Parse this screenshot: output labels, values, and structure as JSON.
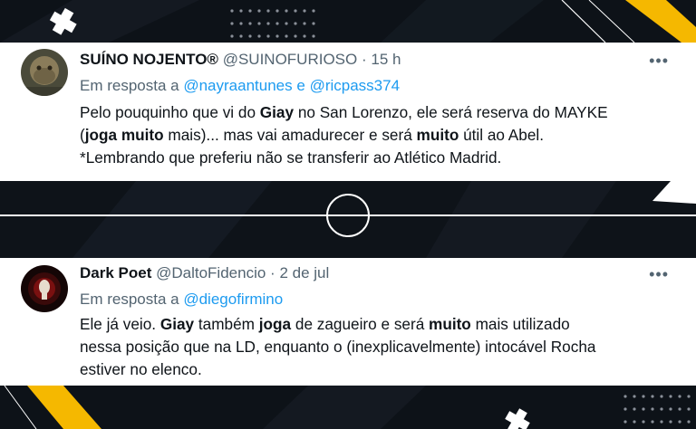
{
  "tweets": [
    {
      "display_name": "SUÍNO NOJENTO®",
      "handle": "@SUINOFURIOSO",
      "separator": "·",
      "time": "15 h",
      "reply_prefix": "Em resposta a",
      "mentions": [
        "@nayraantunes",
        "@ricpass374"
      ],
      "mention_joiner": "e",
      "lines": [
        [
          "Pelo pouquinho que vi do ",
          {
            "b": "Giay"
          },
          " no San Lorenzo, ele será reserva do MAYKE"
        ],
        [
          "(",
          {
            "b": "joga muito"
          },
          " mais)... mas vai amadurecer e será ",
          {
            "b": "muito"
          },
          " útil ao Abel."
        ],
        [
          "*Lembrando que preferiu não se transferir ao Atlético Madrid."
        ]
      ],
      "more_icon": "ellipsis-icon"
    },
    {
      "display_name": "Dark Poet",
      "handle": "@DaltoFidencio",
      "separator": "·",
      "time": "2 de jul",
      "reply_prefix": "Em resposta a",
      "mentions": [
        "@diegofirmino"
      ],
      "mention_joiner": "",
      "lines": [
        [
          "Ele já veio. ",
          {
            "b": "Giay"
          },
          " também ",
          {
            "b": "joga"
          },
          " de zagueiro e será ",
          {
            "b": "muito"
          },
          " mais utilizado"
        ],
        [
          "nessa posição que na LD, enquanto o (inexplicavelmente) intocável Rocha"
        ],
        [
          "estiver no elenco."
        ]
      ],
      "more_icon": "ellipsis-icon"
    }
  ],
  "colors": {
    "background": "#0b0f14",
    "accent_yellow": "#f5b800",
    "card": "#ffffff",
    "text_primary": "#0f1419",
    "text_secondary": "#536471",
    "link": "#1d9bf0"
  }
}
